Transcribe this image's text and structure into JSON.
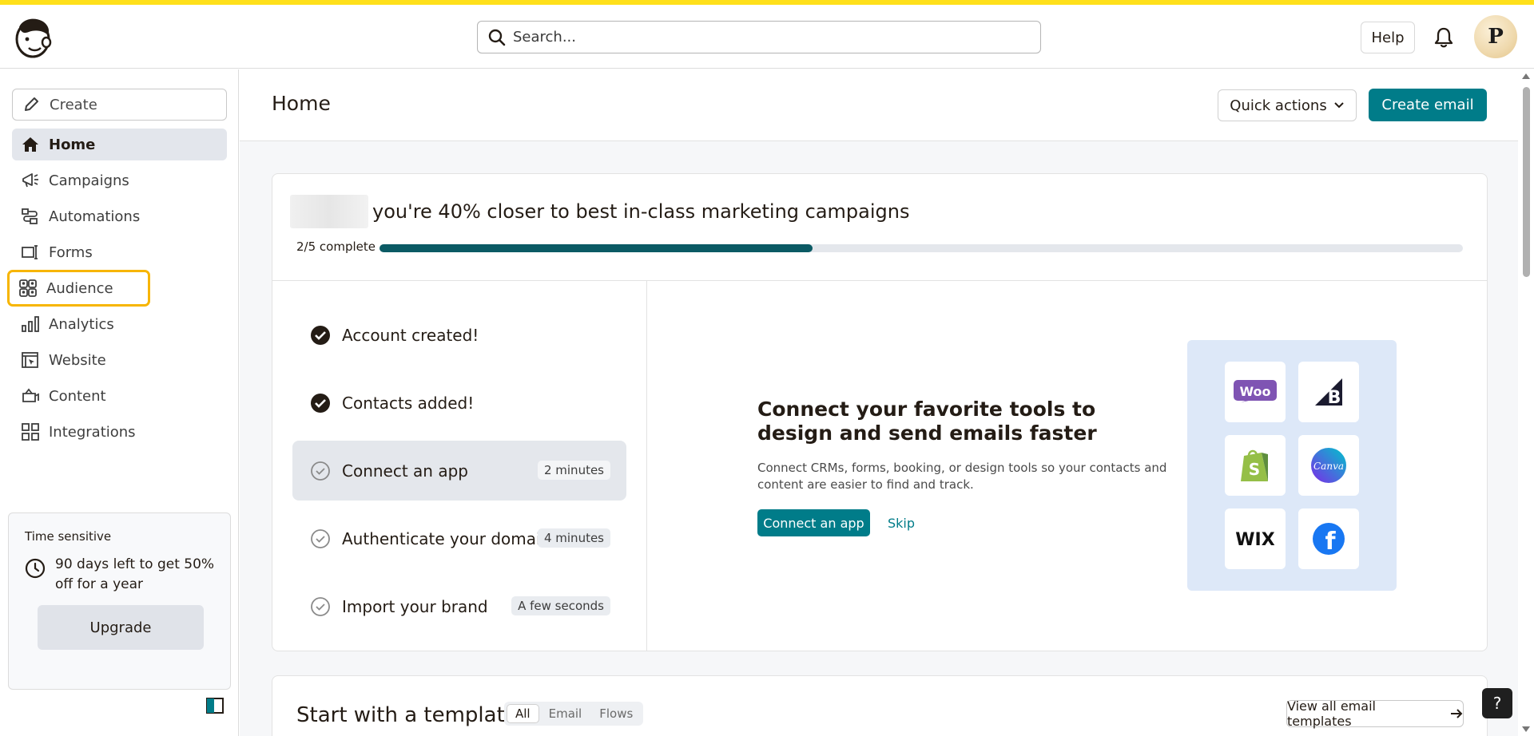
{
  "header": {
    "search_placeholder": "Search...",
    "help_label": "Help",
    "avatar_initial": "P"
  },
  "sidebar": {
    "create_label": "Create",
    "items": [
      {
        "label": "Home",
        "icon": "home-icon",
        "active": true
      },
      {
        "label": "Campaigns",
        "icon": "megaphone-icon"
      },
      {
        "label": "Automations",
        "icon": "automations-icon"
      },
      {
        "label": "Forms",
        "icon": "forms-icon"
      },
      {
        "label": "Audience",
        "icon": "audience-icon",
        "highlighted": true
      },
      {
        "label": "Analytics",
        "icon": "bar-chart-icon"
      },
      {
        "label": "Website",
        "icon": "website-icon"
      },
      {
        "label": "Content",
        "icon": "content-icon"
      },
      {
        "label": "Integrations",
        "icon": "grid-icon"
      }
    ],
    "time_card": {
      "heading": "Time sensitive",
      "message": "90 days left to get 50% off for a year",
      "upgrade_label": "Upgrade"
    }
  },
  "page": {
    "title": "Home",
    "quick_actions_label": "Quick actions",
    "create_email_label": "Create email"
  },
  "progress": {
    "headline": "you're 40% closer to best in-class marketing campaigns",
    "complete_label": "2/5 complete",
    "fraction": 0.4,
    "steps": [
      {
        "label": "Account created!",
        "done": true,
        "duration": ""
      },
      {
        "label": "Contacts added!",
        "done": true,
        "duration": ""
      },
      {
        "label": "Connect an app",
        "done": false,
        "duration": "2 minutes",
        "current": true
      },
      {
        "label": "Authenticate your domain",
        "done": false,
        "duration": "4 minutes"
      },
      {
        "label": "Import your brand",
        "done": false,
        "duration": "A few seconds"
      }
    ]
  },
  "connect": {
    "title": "Connect your favorite tools to design and send emails faster",
    "description": "Connect CRMs, forms, booking, or design tools so your contacts and content are easier to find and track.",
    "button_label": "Connect an app",
    "skip_label": "Skip",
    "tools": [
      "Woo",
      "B",
      "Shopify",
      "Canva",
      "WIX",
      "f"
    ]
  },
  "templates": {
    "title": "Start with a template",
    "filters": [
      "All",
      "Email",
      "Flows"
    ],
    "view_all_label": "View all email templates"
  },
  "colors": {
    "accent": "#007c89",
    "topline": "#ffe01b",
    "highlight": "#f7b500",
    "progress_fill": "#0b5a64"
  }
}
